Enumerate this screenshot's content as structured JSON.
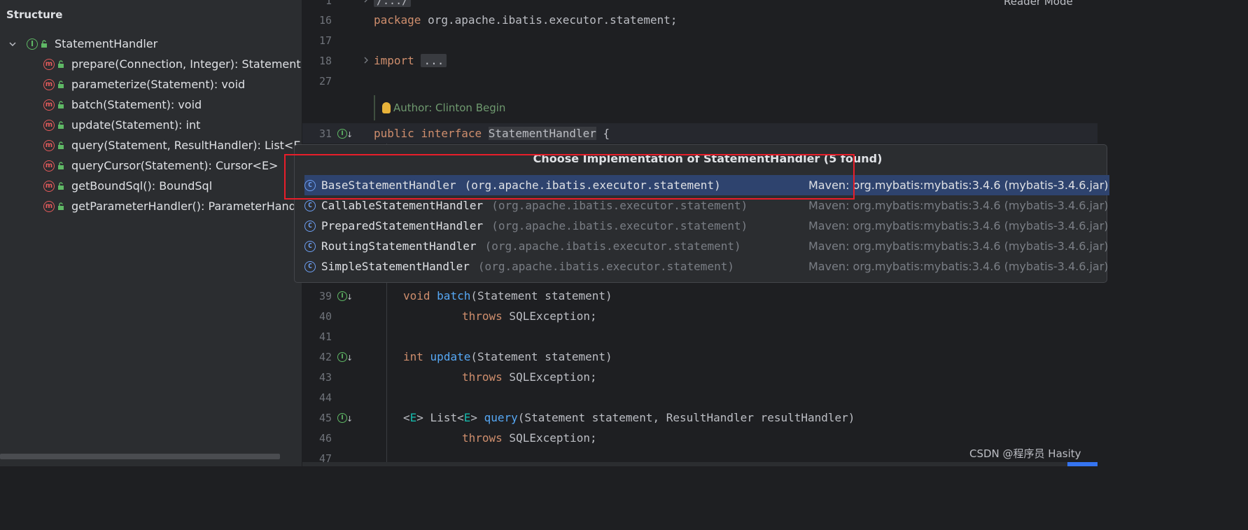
{
  "structure": {
    "title": "Structure",
    "root": "StatementHandler",
    "methods": [
      "prepare(Connection, Integer): Statement",
      "parameterize(Statement): void",
      "batch(Statement): void",
      "update(Statement): int",
      "query(Statement, ResultHandler): List<E>",
      "queryCursor(Statement): Cursor<E>",
      "getBoundSql(): BoundSql",
      "getParameterHandler(): ParameterHandler"
    ]
  },
  "editor": {
    "reader_mode": "Reader Mode",
    "top_fold": "/.../",
    "lines": {
      "l1": "1",
      "l16": "16",
      "l17": "17",
      "l18": "18",
      "l27": "27",
      "l31": "31",
      "l39": "39",
      "l40": "40",
      "l41": "41",
      "l42": "42",
      "l43": "43",
      "l44": "44",
      "l45": "45",
      "l46": "46",
      "l47": "47"
    },
    "package_kw": "package",
    "package_name": " org.apache.ibatis.executor.statement;",
    "import_kw": "import",
    "import_fold": "...",
    "author": "Author: Clinton Begin",
    "public_kw": "public",
    "interface_kw": "interface",
    "iface_name": "StatementHandler",
    "brace": " {",
    "batch_void": "void",
    "batch_fn": "batch",
    "batch_args": "(Statement statement)",
    "throws_kw": "throws",
    "throws_ex": " SQLException;",
    "update_int": "int",
    "update_fn": "update",
    "update_args": "(Statement statement)",
    "query_lt": "<",
    "query_E": "E",
    "query_gt": "> List<",
    "query_E2": "E",
    "query_gt2": "> ",
    "query_fn": "query",
    "query_args": "(Statement statement, ResultHandler resultHandler)"
  },
  "popup": {
    "title": "Choose Implementation of StatementHandler (5 found)",
    "items": [
      {
        "name": "BaseStatementHandler",
        "pkg": "(org.apache.ibatis.executor.statement)",
        "maven": "Maven: org.mybatis:mybatis:3.4.6 (mybatis-3.4.6.jar)"
      },
      {
        "name": "CallableStatementHandler",
        "pkg": "(org.apache.ibatis.executor.statement)",
        "maven": "Maven: org.mybatis:mybatis:3.4.6 (mybatis-3.4.6.jar)"
      },
      {
        "name": "PreparedStatementHandler",
        "pkg": "(org.apache.ibatis.executor.statement)",
        "maven": "Maven: org.mybatis:mybatis:3.4.6 (mybatis-3.4.6.jar)"
      },
      {
        "name": "RoutingStatementHandler",
        "pkg": "(org.apache.ibatis.executor.statement)",
        "maven": "Maven: org.mybatis:mybatis:3.4.6 (mybatis-3.4.6.jar)"
      },
      {
        "name": "SimpleStatementHandler",
        "pkg": "(org.apache.ibatis.executor.statement)",
        "maven": "Maven: org.mybatis:mybatis:3.4.6 (mybatis-3.4.6.jar)"
      }
    ]
  },
  "watermark": "CSDN @程序员 Hasity",
  "icons": {
    "interface": "I",
    "method": "m",
    "class": "C"
  },
  "colors": {
    "accent_selection": "#2e436e",
    "highlight_box": "#e81e2a",
    "keyword": "#cf8e6d",
    "function": "#56a8f5"
  }
}
